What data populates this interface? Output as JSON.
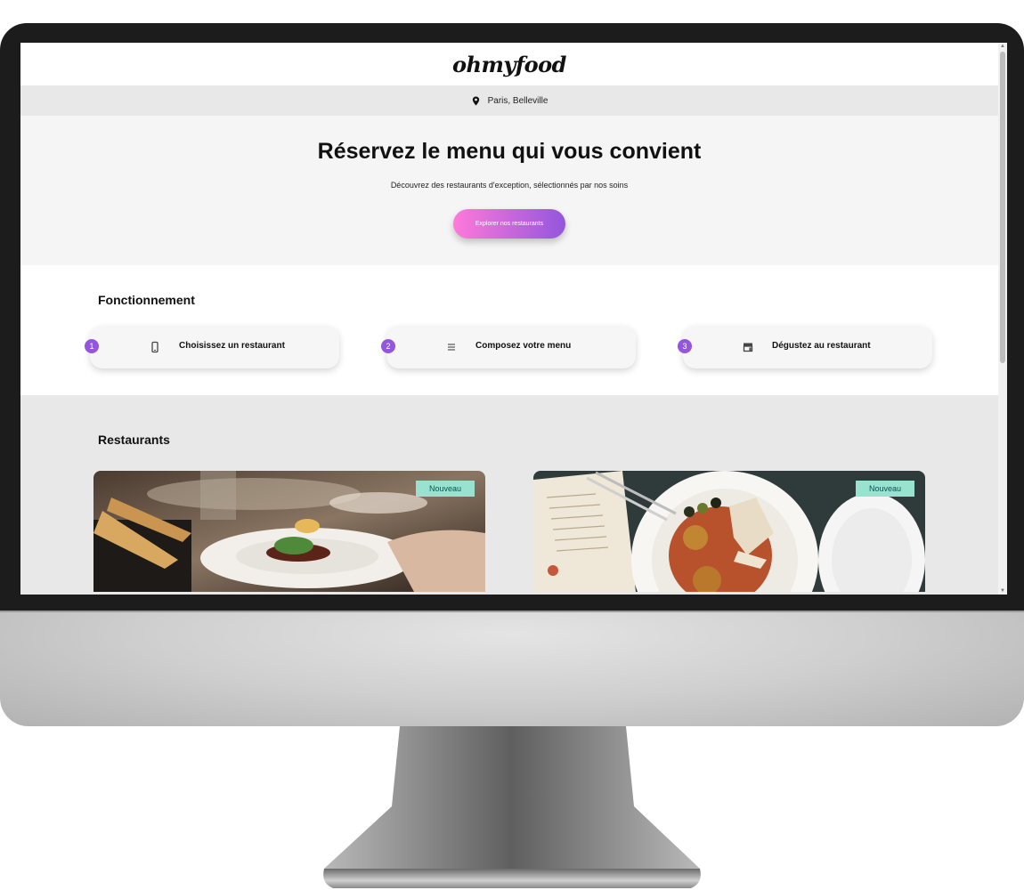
{
  "header": {
    "logo": "ohmyfood"
  },
  "location": {
    "text": "Paris, Belleville",
    "icon": "map-pin-icon"
  },
  "hero": {
    "title": "Réservez le menu qui vous convient",
    "subtitle": "Découvrez des restaurants d'exception, sélectionnés par nos soins",
    "button_label": "Explorer nos restaurants",
    "button_gradient": [
      "#ff79da",
      "#9356dc"
    ]
  },
  "how_it_works": {
    "title": "Fonctionnement",
    "steps": [
      {
        "number": "1",
        "label": "Choisissez un restaurant",
        "icon": "mobile-phone-icon"
      },
      {
        "number": "2",
        "label": "Composez votre menu",
        "icon": "list-icon"
      },
      {
        "number": "3",
        "label": "Dégustez au restaurant",
        "icon": "store-icon"
      }
    ]
  },
  "restaurants": {
    "title": "Restaurants",
    "cards": [
      {
        "badge": "Nouveau",
        "image": "plated-dish-photo"
      },
      {
        "badge": "Nouveau",
        "image": "tapas-plate-photo"
      }
    ]
  },
  "colors": {
    "accent": "#9356dc",
    "badge": "#99e2d0",
    "hero_bg": "#f5f5f5",
    "section_bg": "#e8e8e8"
  }
}
